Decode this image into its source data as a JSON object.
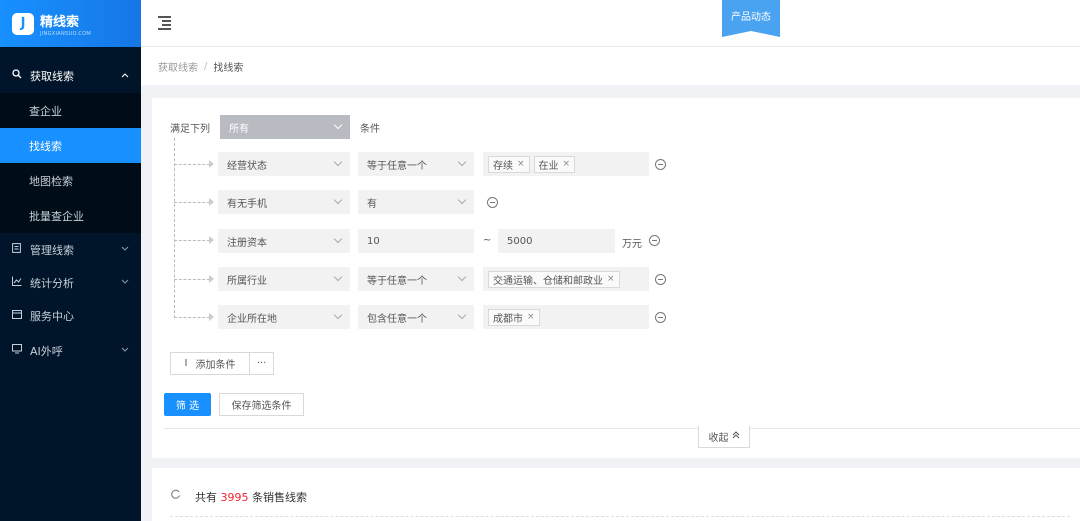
{
  "app": {
    "logo_mark": "J",
    "title": "精线索",
    "subtitle": "JINGXIANSUO.COM"
  },
  "header": {
    "ribbon": "产品动态"
  },
  "sidebar": {
    "group": {
      "label": "获取线索",
      "icon": "search-icon"
    },
    "sub_items": [
      {
        "label": "查企业",
        "active": false
      },
      {
        "label": "找线索",
        "active": true
      },
      {
        "label": "地图检索",
        "active": false
      },
      {
        "label": "批量查企业",
        "active": false
      }
    ],
    "items": [
      {
        "label": "管理线索",
        "icon": "document-icon",
        "expandable": true
      },
      {
        "label": "统计分析",
        "icon": "chart-icon",
        "expandable": true
      },
      {
        "label": "服务中心",
        "icon": "card-icon",
        "expandable": false
      },
      {
        "label": "AI外呼",
        "icon": "monitor-icon",
        "expandable": true
      }
    ]
  },
  "breadcrumb": {
    "parent": "获取线索",
    "separator": "/",
    "current": "找线索"
  },
  "filter": {
    "match_prefix": "满足下列",
    "match_value": "所有",
    "match_suffix": "条件",
    "conditions": [
      {
        "field": "经营状态",
        "operator": "等于任意一个",
        "tags": [
          "存续",
          "在业"
        ]
      },
      {
        "field": "有无手机",
        "operator": "有"
      },
      {
        "field": "注册资本",
        "min": "10",
        "range_sep": "~",
        "max": "5000",
        "unit": "万元"
      },
      {
        "field": "所属行业",
        "operator": "等于任意一个",
        "tags": [
          "交通运输、仓储和邮政业"
        ]
      },
      {
        "field": "企业所在地",
        "operator": "包含任意一个",
        "tags": [
          "成都市"
        ]
      }
    ],
    "add_condition": "添加条件",
    "add_condition_icon": "I",
    "more": "···",
    "filter_button": "筛 选",
    "save_button": "保存筛选条件",
    "collapse": "收起",
    "collapse_icon": "chevrons-up-icon"
  },
  "results": {
    "prefix": "共有",
    "count": "3995",
    "suffix": "条销售线索",
    "count_color": "#f5222d"
  },
  "colors": {
    "primary": "#1890ff",
    "sidebar": "#001529"
  }
}
